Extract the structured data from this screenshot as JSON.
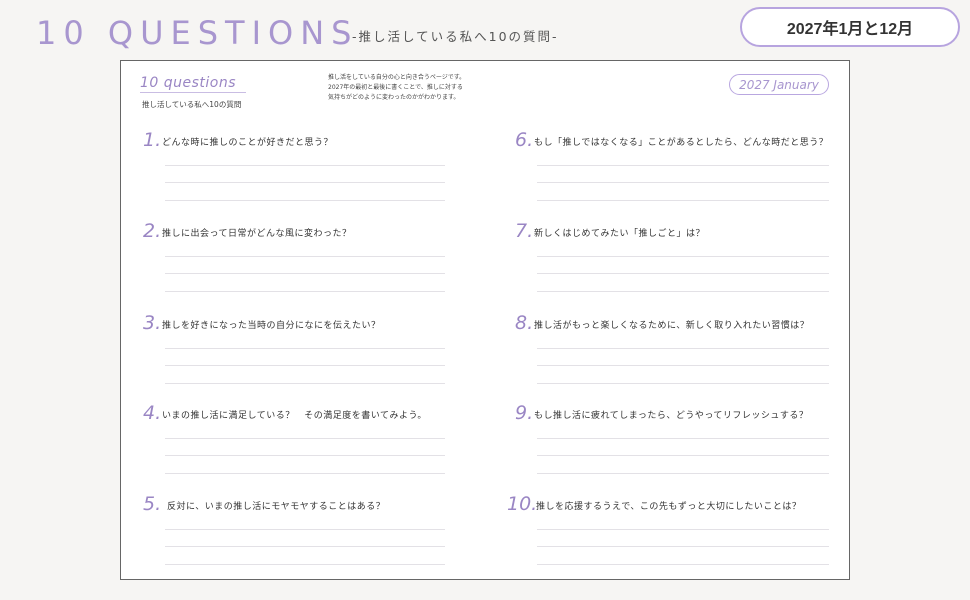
{
  "header": {
    "title": "10 QUESTIONS",
    "subtitle": "-推し活している私へ10の質問-",
    "badge": "2027年1月と12月"
  },
  "sheet": {
    "title": "10 questions",
    "subtitle": "推し活している私へ10の質問",
    "intro": [
      "推し活をしている自分の心と向き合うページです。",
      "2027年の最初と最後に書くことで、推しに対する",
      "気持ちがどのように変わったのかがわかります。"
    ],
    "year_badge": "2027 January"
  },
  "questions": [
    {
      "num": "1.",
      "text": "どんな時に推しのことが好きだと思う？"
    },
    {
      "num": "2.",
      "text": "推しに出会って日常がどんな風に変わった？"
    },
    {
      "num": "3.",
      "text": "推しを好きになった当時の自分になにを伝えたい？"
    },
    {
      "num": "4.",
      "text": "いまの推し活に満足している？　その満足度を書いてみよう。"
    },
    {
      "num": "5.",
      "text": "反対に、いまの推し活にモヤモヤすることはある？"
    },
    {
      "num": "6.",
      "text": "もし「推しではなくなる」ことがあるとしたら、どんな時だと思う？"
    },
    {
      "num": "7.",
      "text": "新しくはじめてみたい「推しごと」は？"
    },
    {
      "num": "8.",
      "text": "推し活がもっと楽しくなるために、新しく取り入れたい習慣は？"
    },
    {
      "num": "9.",
      "text": "もし推し活に疲れてしまったら、どうやってリフレッシュする？"
    },
    {
      "num": "10.",
      "text": "推しを応援するうえで、この先もずっと大切にしたいことは？"
    }
  ],
  "colors": {
    "accent": "#a896cf",
    "border": "#666666",
    "background": "#f6f5f3"
  }
}
